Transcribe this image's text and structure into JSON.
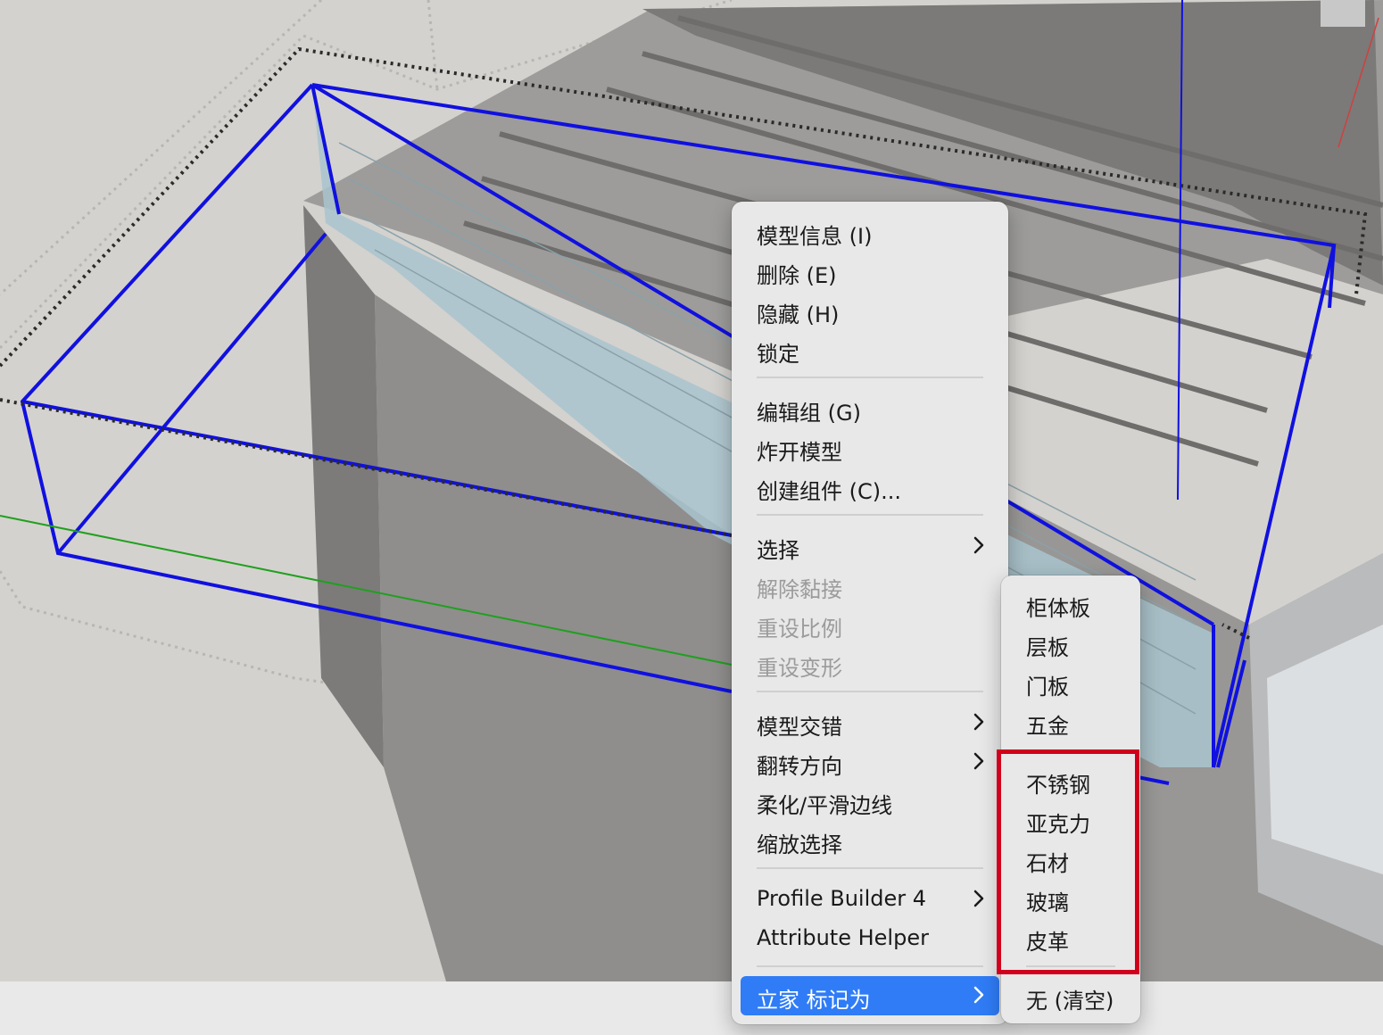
{
  "context_menu": {
    "groups": [
      [
        {
          "label": "模型信息 (I)",
          "enabled": true
        },
        {
          "label": "删除 (E)",
          "enabled": true
        },
        {
          "label": "隐藏 (H)",
          "enabled": true
        },
        {
          "label": "锁定",
          "enabled": true
        }
      ],
      [
        {
          "label": "编辑组 (G)",
          "enabled": true
        },
        {
          "label": "炸开模型",
          "enabled": true
        },
        {
          "label": "创建组件 (C)...",
          "enabled": true
        }
      ],
      [
        {
          "label": "选择",
          "enabled": true,
          "submenu": true
        },
        {
          "label": "解除黏接",
          "enabled": false
        },
        {
          "label": "重设比例",
          "enabled": false
        },
        {
          "label": "重设变形",
          "enabled": false
        }
      ],
      [
        {
          "label": "模型交错",
          "enabled": true,
          "submenu": true
        },
        {
          "label": "翻转方向",
          "enabled": true,
          "submenu": true
        },
        {
          "label": "柔化/平滑边线",
          "enabled": true
        },
        {
          "label": "缩放选择",
          "enabled": true
        }
      ],
      [
        {
          "label": "Profile Builder 4",
          "enabled": true,
          "submenu": true
        },
        {
          "label": "Attribute Helper",
          "enabled": true
        }
      ],
      [
        {
          "label": "立家 标记为",
          "enabled": true,
          "submenu": true,
          "active": true
        }
      ]
    ]
  },
  "submenu": {
    "groups": [
      [
        "柜体板",
        "层板",
        "门板",
        "五金"
      ],
      [
        "不锈钢",
        "亚克力",
        "石材",
        "玻璃",
        "皮革"
      ],
      [
        "无 (清空)"
      ]
    ]
  },
  "colors": {
    "selection_edge": "#1010e0",
    "green_axis": "#1fa01f",
    "red_axis": "#d04040",
    "menu_highlight": "#2f7cf6",
    "annotation_box": "#d0001c"
  },
  "icons": {
    "submenu_arrow": "chevron-right-icon"
  }
}
